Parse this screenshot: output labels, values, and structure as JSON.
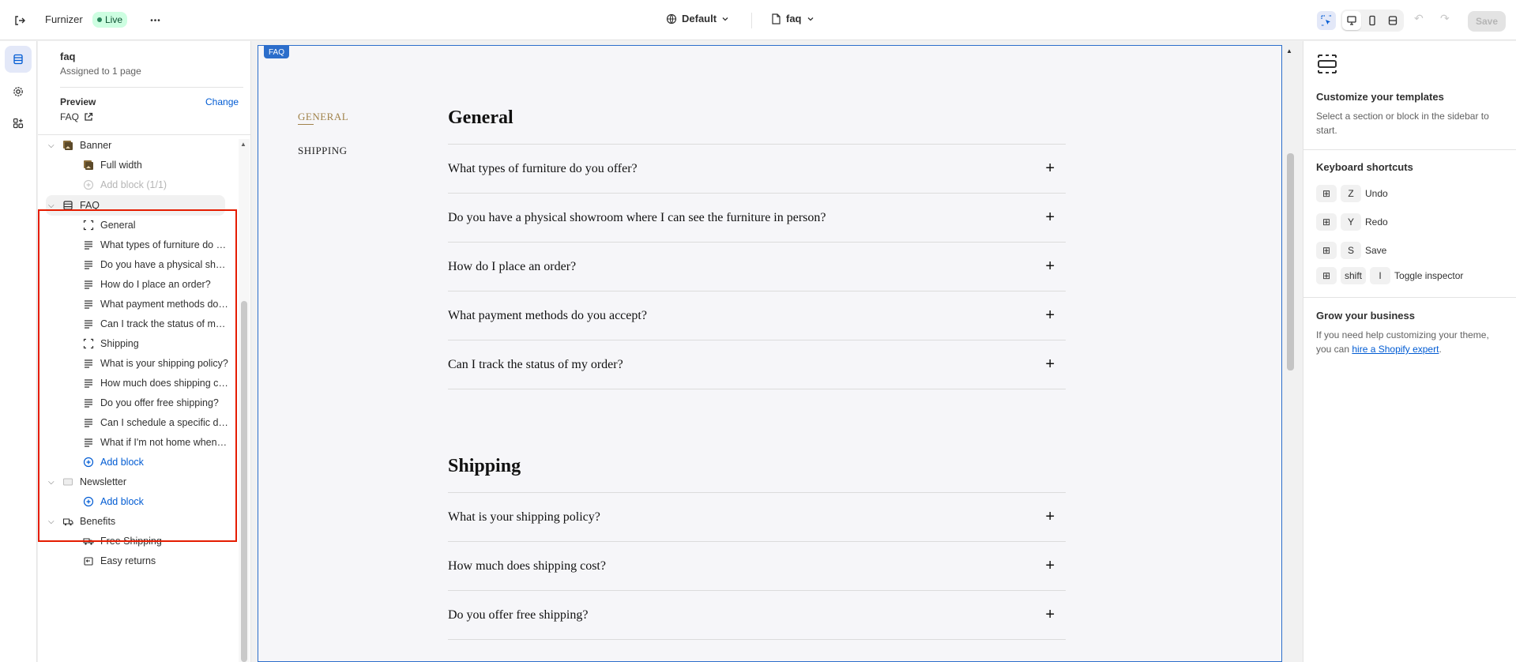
{
  "topbar": {
    "store_name": "Furnizer",
    "live_badge": "Live",
    "more_label": "•••",
    "theme_selector": "Default",
    "page_selector": "faq",
    "save_label": "Save"
  },
  "sidebar": {
    "template_title": "faq",
    "assigned_text": "Assigned to 1 page",
    "preview_label": "Preview",
    "change_label": "Change",
    "preview_page": "FAQ",
    "tree": [
      {
        "label": "Banner",
        "level": 1,
        "icon": "image-section-icon"
      },
      {
        "label": "Full width",
        "level": 2,
        "icon": "image-block-icon"
      },
      {
        "label": "Add block (1/1)",
        "level": 2,
        "icon": "plus-circle-icon",
        "muted": true
      },
      {
        "label": "FAQ",
        "level": 1,
        "icon": "section-icon",
        "selected": true
      },
      {
        "label": "General",
        "level": 2,
        "icon": "group-icon"
      },
      {
        "label": "What types of furniture do you offer?",
        "level": 2,
        "icon": "text-icon"
      },
      {
        "label": "Do you have a physical showroom where I can see the furniture in person?",
        "level": 2,
        "icon": "text-icon"
      },
      {
        "label": "How do I place an order?",
        "level": 2,
        "icon": "text-icon"
      },
      {
        "label": "What payment methods do you accept?",
        "level": 2,
        "icon": "text-icon"
      },
      {
        "label": "Can I track the status of my order?",
        "level": 2,
        "icon": "text-icon"
      },
      {
        "label": "Shipping",
        "level": 2,
        "icon": "group-icon"
      },
      {
        "label": "What is your shipping policy?",
        "level": 2,
        "icon": "text-icon"
      },
      {
        "label": "How much does shipping cost?",
        "level": 2,
        "icon": "text-icon"
      },
      {
        "label": "Do you offer free shipping?",
        "level": 2,
        "icon": "text-icon"
      },
      {
        "label": "Can I schedule a specific delivery date?",
        "level": 2,
        "icon": "text-icon"
      },
      {
        "label": "What if I'm not home when my order arrives?",
        "level": 2,
        "icon": "text-icon"
      },
      {
        "label": "Add block",
        "level": 2,
        "icon": "plus-circle-icon",
        "blue": true
      },
      {
        "label": "Newsletter",
        "level": 1,
        "icon": "newsletter-icon"
      },
      {
        "label": "Add block",
        "level": 2,
        "icon": "plus-circle-icon",
        "blue": true
      },
      {
        "label": "Benefits",
        "level": 1,
        "icon": "benefits-icon"
      },
      {
        "label": "Free Shipping",
        "level": 2,
        "icon": "truck-icon"
      },
      {
        "label": "Easy returns",
        "level": 2,
        "icon": "return-icon"
      }
    ]
  },
  "canvas": {
    "section_tag": "FAQ",
    "nav": [
      "GENERAL",
      "SHIPPING"
    ],
    "groups": [
      {
        "heading": "General",
        "questions": [
          "What types of furniture do you offer?",
          "Do you have a physical showroom where I can see the furniture in person?",
          "How do I place an order?",
          "What payment methods do you accept?",
          "Can I track the status of my order?"
        ]
      },
      {
        "heading": "Shipping",
        "questions": [
          "What is your shipping policy?",
          "How much does shipping cost?",
          "Do you offer free shipping?"
        ]
      }
    ]
  },
  "inspector": {
    "title": "Customize your templates",
    "description": "Select a section or block in the sidebar to start.",
    "shortcuts_title": "Keyboard shortcuts",
    "shortcuts": [
      {
        "keys": [
          "⊞",
          "Z"
        ],
        "label": "Undo"
      },
      {
        "keys": [
          "⊞",
          "Y"
        ],
        "label": "Redo"
      },
      {
        "keys": [
          "⊞",
          "S"
        ],
        "label": "Save"
      },
      {
        "keys": [
          "⊞",
          "shift",
          "I"
        ],
        "label": "Toggle inspector"
      }
    ],
    "grow_title": "Grow your business",
    "grow_text": "If you need help customizing your theme, you can ",
    "grow_link": "hire a Shopify expert",
    "grow_end": "."
  },
  "colors": {
    "accent_blue": "#005bd3",
    "highlight_red": "#e51c00",
    "live_green": "#29845a",
    "faq_nav_gold": "#a0824a"
  }
}
